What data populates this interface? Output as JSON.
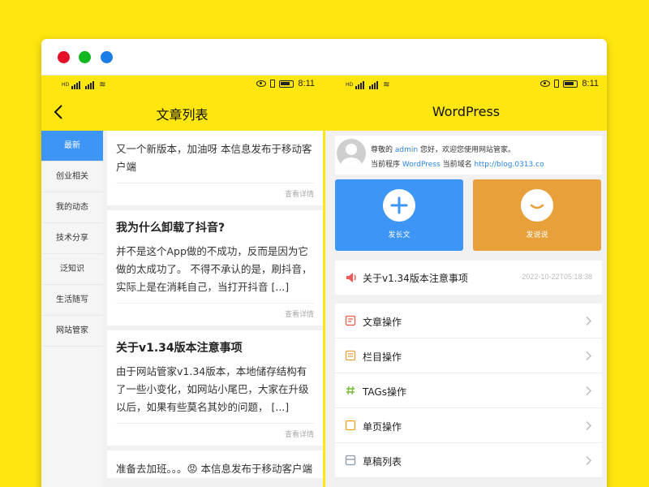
{
  "window": {
    "dot_colors": [
      "#e60f29",
      "#12b81f",
      "#1b7de8"
    ]
  },
  "statusbar": {
    "time": "8:11",
    "left_labels": [
      "HD",
      "HD"
    ]
  },
  "left_screen": {
    "title": "文章列表",
    "categories": [
      "最新",
      "创业相关",
      "我的动态",
      "技术分享",
      "泛知识",
      "生活随写",
      "网站管家"
    ],
    "active_category": "最新",
    "articles": [
      {
        "title": "",
        "body": "又一个新版本，加油呀 本信息发布于移动客户端",
        "more": "查看详情"
      },
      {
        "title": "我为什么卸载了抖音?",
        "body": "并不是这个App做的不成功，反而是因为它做的太成功了。 不得不承认的是，刷抖音，实际上是在消耗自己，当打开抖音 [...]",
        "more": "查看详情"
      },
      {
        "title": "关于v1.34版本注意事项",
        "body": "由于网站管家v1.34版本，本地储存结构有了一些小变化，如网站小尾巴，大家在升级以后，如果有些莫名其妙的问题， [...]",
        "more": "查看详情"
      },
      {
        "title": "",
        "body": "准备去加班。。。😡 本信息发布于移动客户端",
        "more": ""
      }
    ]
  },
  "right_screen": {
    "title": "WordPress",
    "welcome": {
      "line1_pre": "尊敬的",
      "user": "admin",
      "line1_post": "您好，欢迎您使用网站管家。",
      "line2_pre": "当前程序",
      "program": "WordPress",
      "line2_mid": "当前域名",
      "domain": "http://blog.0313.co"
    },
    "tiles": [
      {
        "label": "发长文",
        "color": "#3d95f5",
        "icon": "plus-icon"
      },
      {
        "label": "发说说",
        "color": "#e8a13a",
        "icon": "chat-bubble-icon"
      }
    ],
    "notice": {
      "text": "关于v1.34版本注意事项",
      "time": "2022-10-22T05:18:38",
      "icon": "speaker-icon"
    },
    "menu": [
      {
        "label": "文章操作",
        "icon": "article-icon",
        "color": "#e85c4a"
      },
      {
        "label": "栏目操作",
        "icon": "column-icon",
        "color": "#e8a13a"
      },
      {
        "label": "TAGs操作",
        "icon": "hash-icon",
        "color": "#7ab83a"
      },
      {
        "label": "单页操作",
        "icon": "page-icon",
        "color": "#f0a020"
      },
      {
        "label": "草稿列表",
        "icon": "draft-icon",
        "color": "#8a9ab0"
      }
    ]
  }
}
